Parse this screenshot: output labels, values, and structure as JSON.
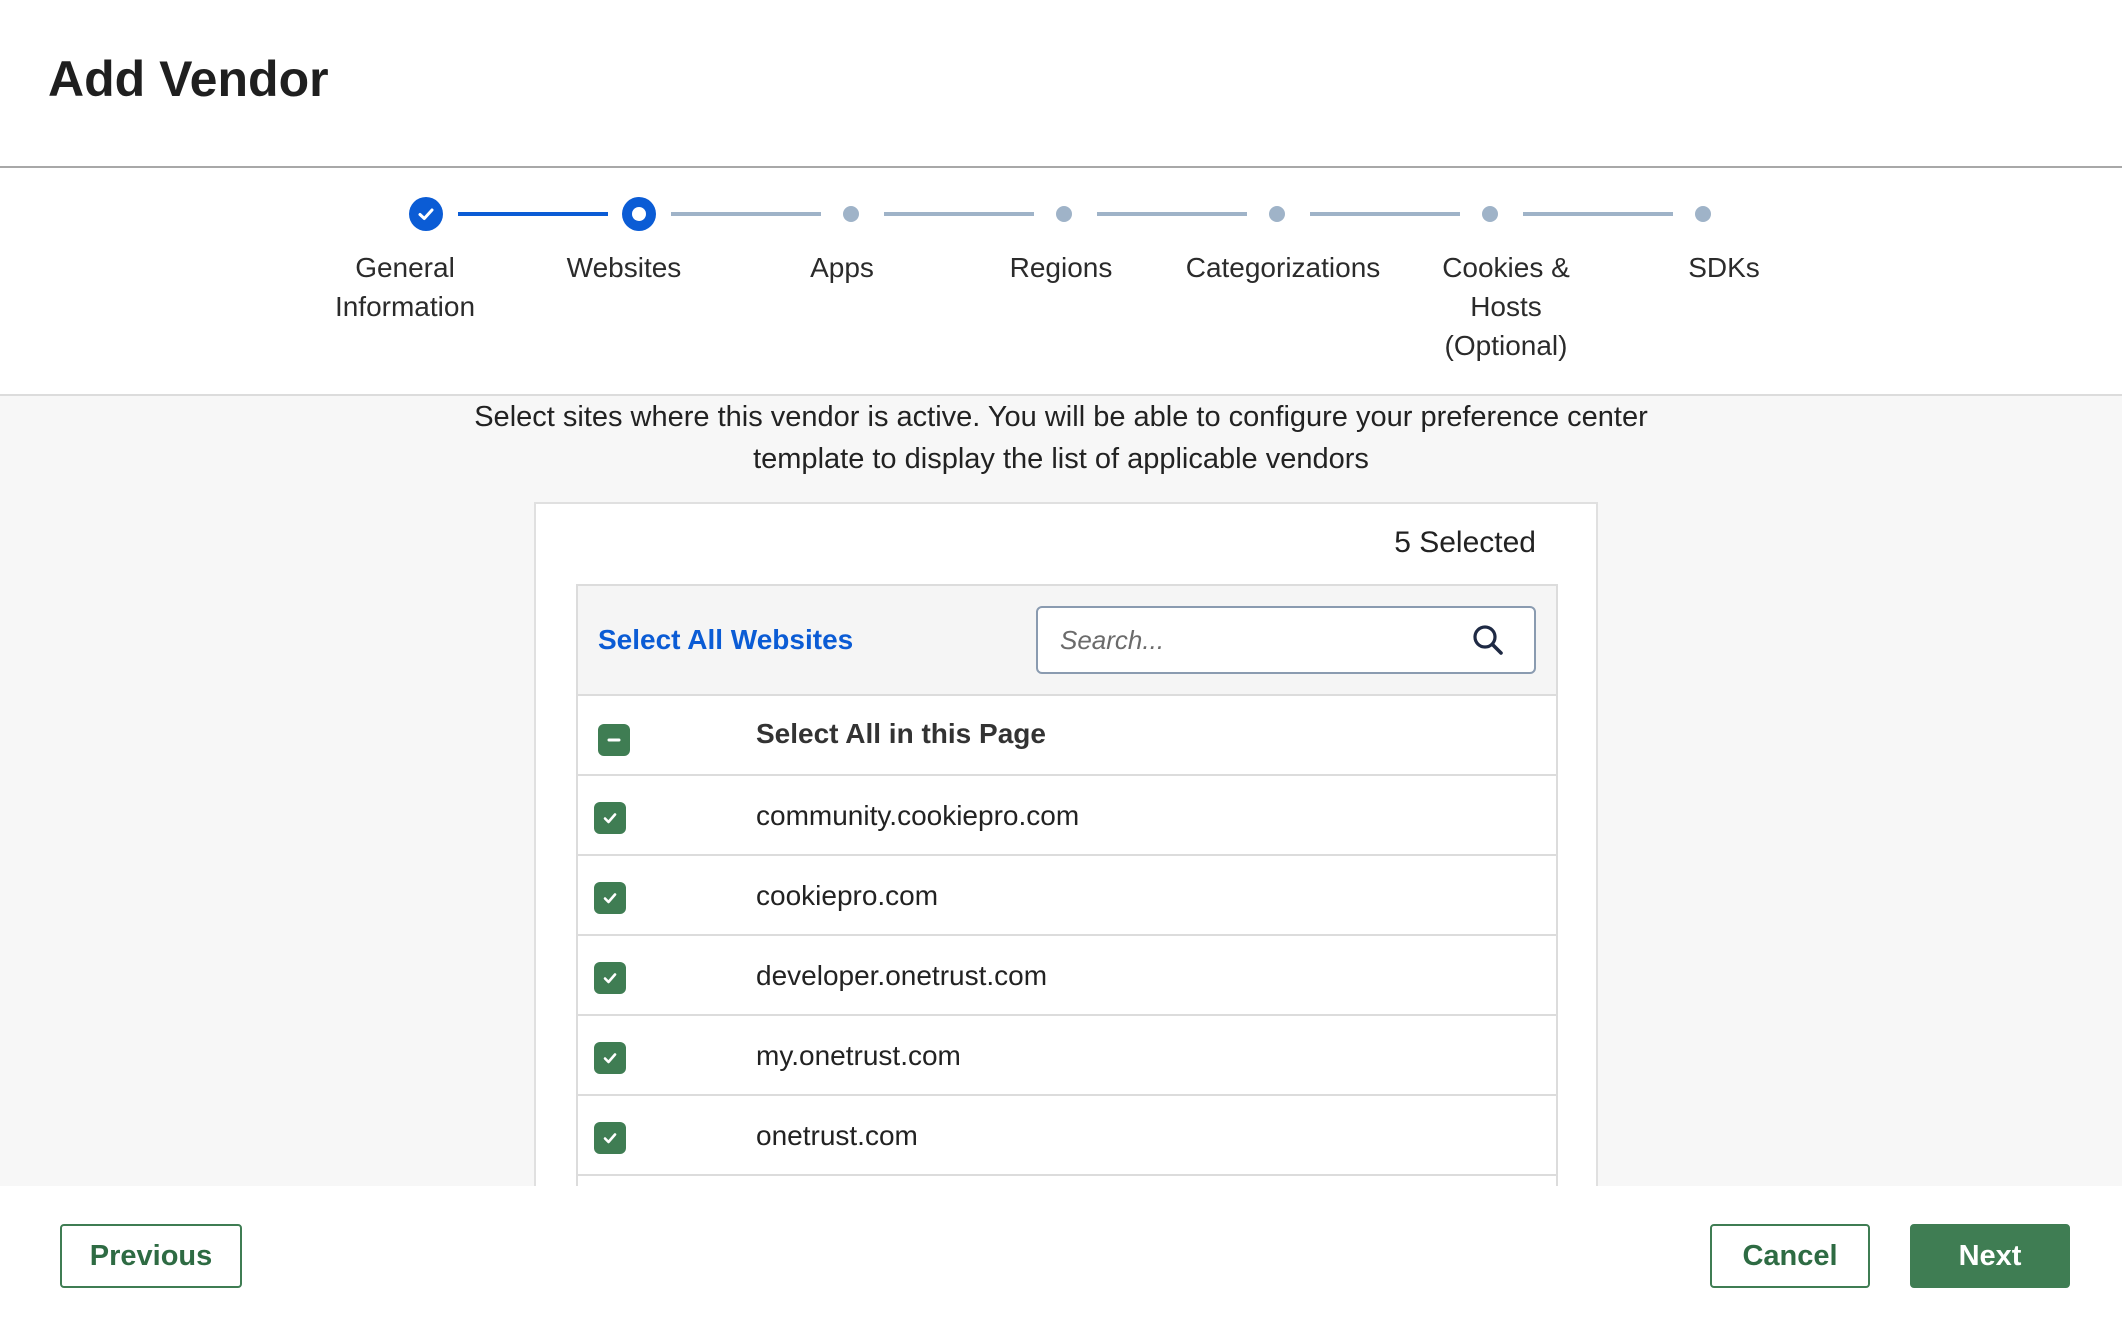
{
  "page": {
    "title": "Add Vendor"
  },
  "stepper": {
    "steps": [
      {
        "label": "General\nInformation",
        "state": "complete"
      },
      {
        "label": "Websites",
        "state": "current"
      },
      {
        "label": "Apps",
        "state": "pending"
      },
      {
        "label": "Regions",
        "state": "pending"
      },
      {
        "label": "Categorizations",
        "state": "pending"
      },
      {
        "label": "Cookies &\nHosts\n(Optional)",
        "state": "pending"
      },
      {
        "label": "SDKs",
        "state": "pending"
      }
    ],
    "colors": {
      "active": "#0b5cd5",
      "inactive": "#9fb3c8"
    }
  },
  "websites": {
    "description": "Select sites where this vendor is active. You will be able to configure your preference center template to display the list of applicable vendors",
    "selected_count": "5 Selected",
    "select_all_link": "Select All Websites",
    "search": {
      "placeholder": "Search...",
      "value": "",
      "icon": "search-icon"
    },
    "select_all_page_label": "Select All in this Page",
    "select_all_page_state": "indeterminate",
    "rows": [
      {
        "label": "community.cookiepro.com",
        "checked": true
      },
      {
        "label": "cookiepro.com",
        "checked": true
      },
      {
        "label": "developer.onetrust.com",
        "checked": true
      },
      {
        "label": "my.onetrust.com",
        "checked": true
      },
      {
        "label": "onetrust.com",
        "checked": true
      }
    ]
  },
  "footer": {
    "previous_label": "Previous",
    "cancel_label": "Cancel",
    "next_label": "Next"
  },
  "theme": {
    "primary_green": "#3f7d53",
    "link_blue": "#0b5cd5"
  }
}
